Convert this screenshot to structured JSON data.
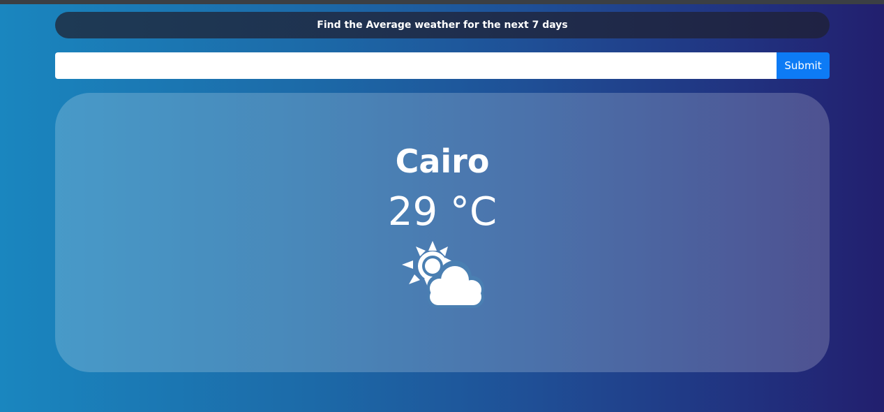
{
  "header": {
    "title": "Find the Average weather for the next 7 days"
  },
  "search": {
    "value": "",
    "placeholder": "",
    "submit_label": "Submit"
  },
  "weather": {
    "city": "Cairo",
    "temperature": "29 °C",
    "icon": "partly-cloudy-day-icon"
  },
  "colors": {
    "submit_button": "#0d7bf5",
    "background_left": "#1a86bf",
    "background_right": "#221f6e",
    "text": "#ffffff"
  }
}
